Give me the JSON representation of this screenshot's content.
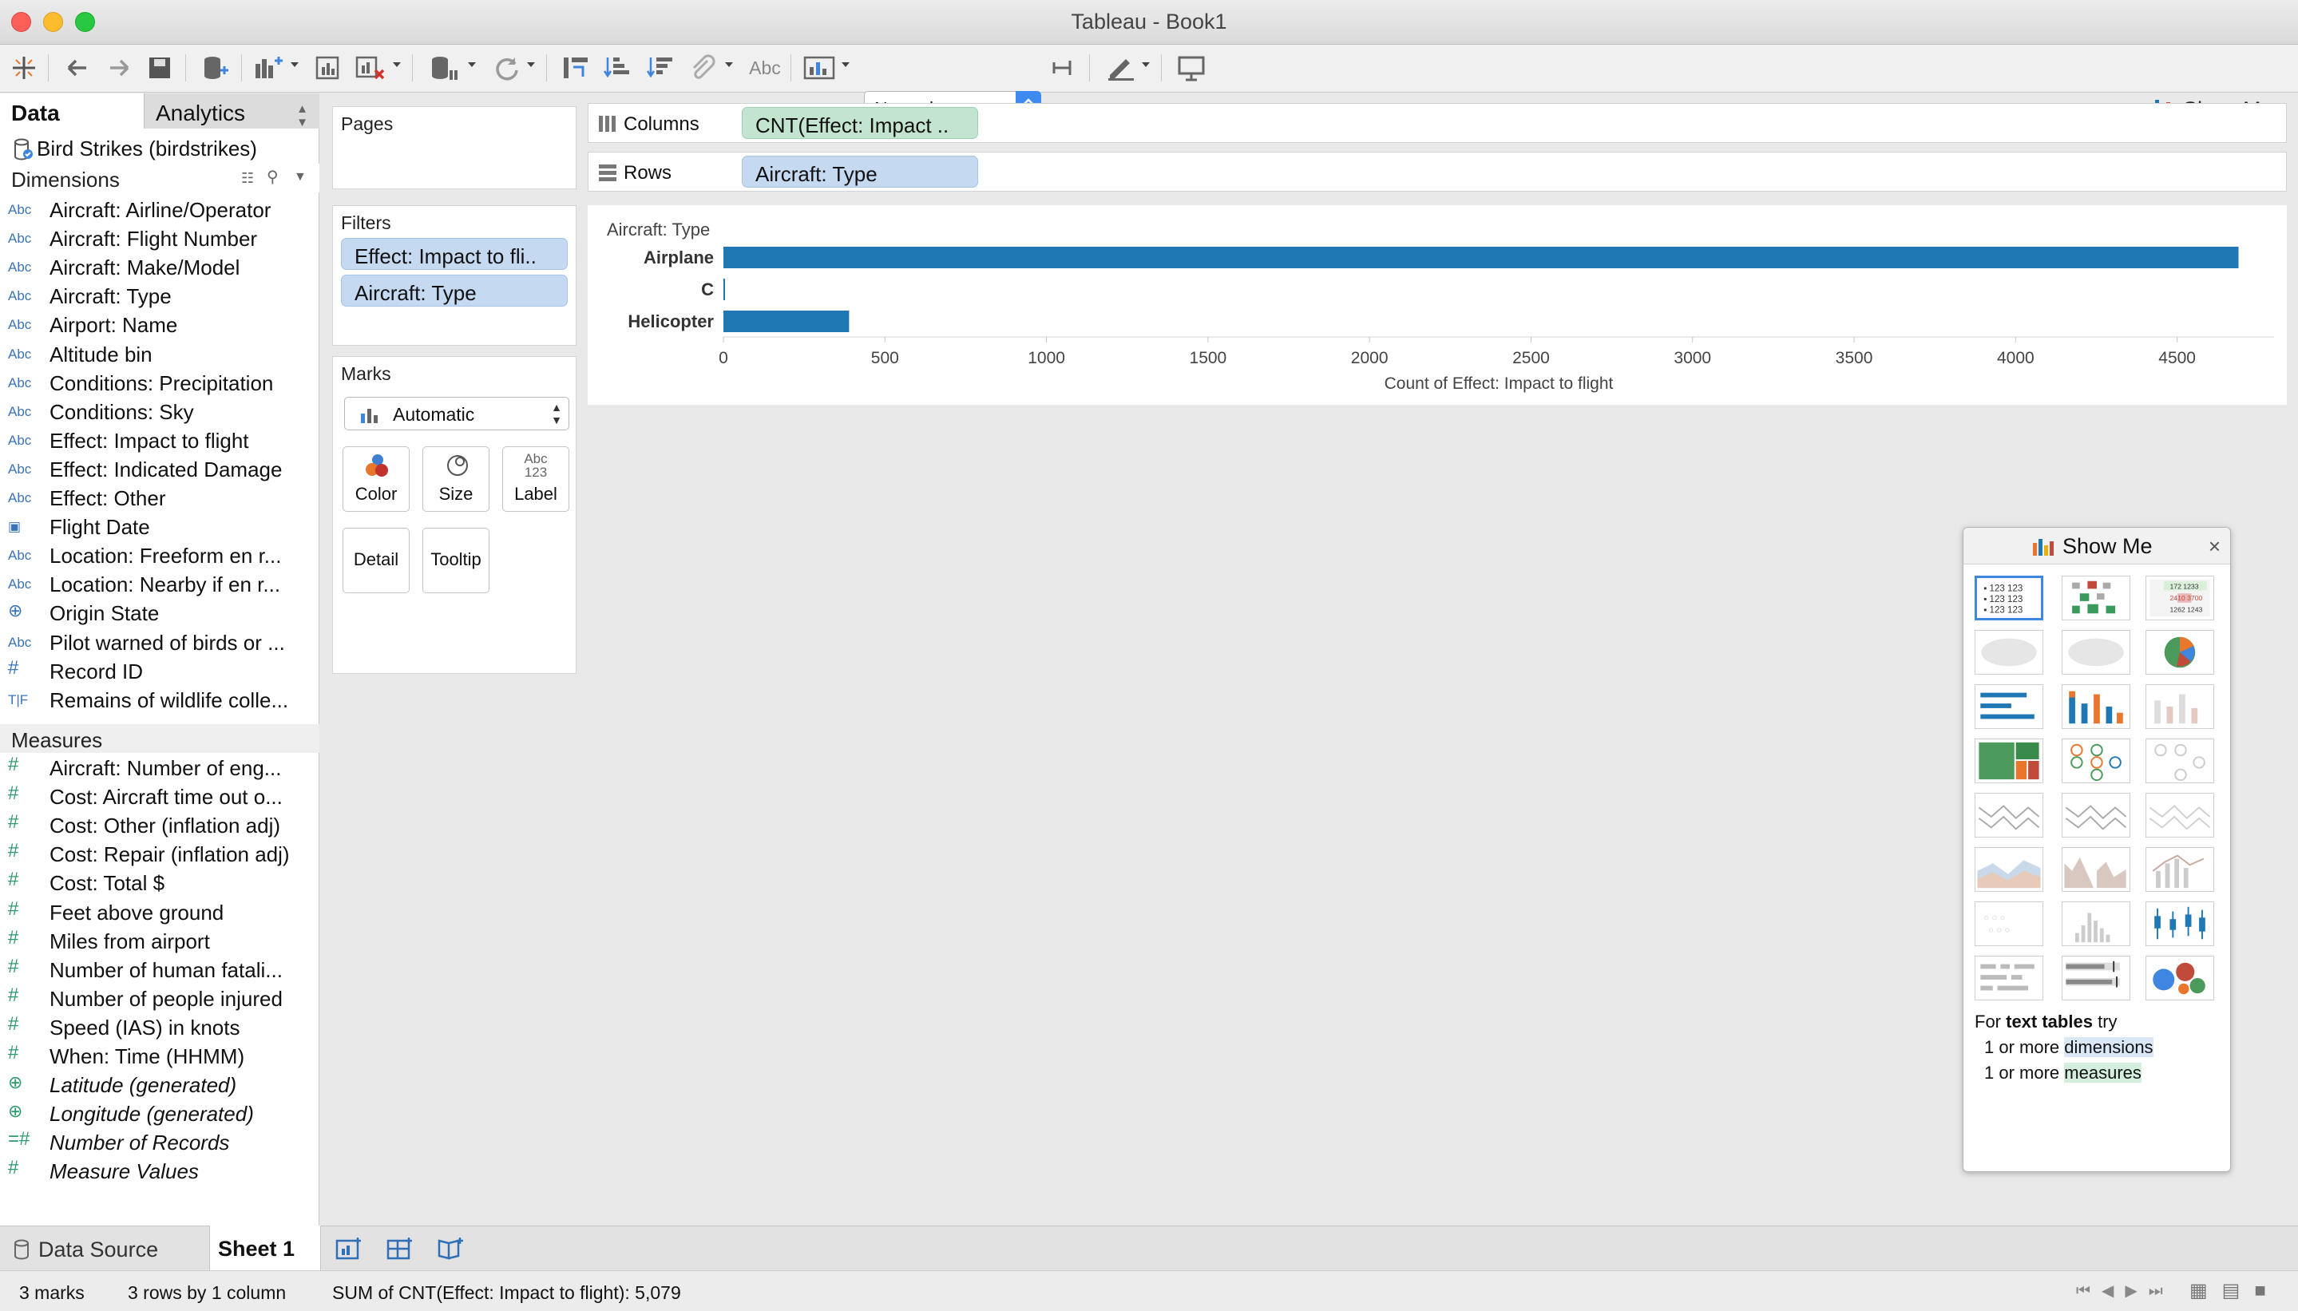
{
  "window": {
    "title": "Tableau - Book1"
  },
  "toolbar": {
    "fit_mode": "Normal",
    "show_me_label": "Show Me",
    "abc_label": "Abc"
  },
  "side_tabs": {
    "data": "Data",
    "analytics": "Analytics"
  },
  "datasource": {
    "name": "Bird Strikes (birdstrikes)"
  },
  "dimensions": {
    "header": "Dimensions",
    "items": [
      {
        "type": "Abc",
        "label": "Aircraft: Airline/Operator"
      },
      {
        "type": "Abc",
        "label": "Aircraft: Flight Number"
      },
      {
        "type": "Abc",
        "label": "Aircraft: Make/Model"
      },
      {
        "type": "Abc",
        "label": "Aircraft: Type"
      },
      {
        "type": "Abc",
        "label": "Airport: Name"
      },
      {
        "type": "Abc",
        "label": "Altitude bin"
      },
      {
        "type": "Abc",
        "label": "Conditions: Precipitation"
      },
      {
        "type": "Abc",
        "label": "Conditions: Sky"
      },
      {
        "type": "Abc",
        "label": "Effect: Impact to flight"
      },
      {
        "type": "Abc",
        "label": "Effect: Indicated Damage"
      },
      {
        "type": "Abc",
        "label": "Effect: Other"
      },
      {
        "type": "date",
        "label": "Flight Date"
      },
      {
        "type": "Abc",
        "label": "Location: Freeform en r..."
      },
      {
        "type": "Abc",
        "label": "Location: Nearby if en r..."
      },
      {
        "type": "geo",
        "label": "Origin State"
      },
      {
        "type": "Abc",
        "label": "Pilot warned of birds or ..."
      },
      {
        "type": "#",
        "label": "Record ID"
      },
      {
        "type": "T|F",
        "label": "Remains of wildlife colle..."
      }
    ]
  },
  "measures": {
    "header": "Measures",
    "items": [
      {
        "type": "#",
        "label": "Aircraft: Number of eng...",
        "italic": false
      },
      {
        "type": "#",
        "label": "Cost: Aircraft time out o...",
        "italic": false
      },
      {
        "type": "#",
        "label": "Cost: Other (inflation adj)",
        "italic": false
      },
      {
        "type": "#",
        "label": "Cost: Repair (inflation adj)",
        "italic": false
      },
      {
        "type": "#",
        "label": "Cost: Total $",
        "italic": false
      },
      {
        "type": "#",
        "label": "Feet above ground",
        "italic": false
      },
      {
        "type": "#",
        "label": "Miles from airport",
        "italic": false
      },
      {
        "type": "#",
        "label": "Number of human fatali...",
        "italic": false
      },
      {
        "type": "#",
        "label": "Number of people injured",
        "italic": false
      },
      {
        "type": "#",
        "label": "Speed (IAS) in knots",
        "italic": false
      },
      {
        "type": "#",
        "label": "When: Time (HHMM)",
        "italic": false
      },
      {
        "type": "geo",
        "label": "Latitude (generated)",
        "italic": true
      },
      {
        "type": "geo",
        "label": "Longitude (generated)",
        "italic": true
      },
      {
        "type": "=#",
        "label": "Number of Records",
        "italic": true
      },
      {
        "type": "#",
        "label": "Measure Values",
        "italic": true
      }
    ]
  },
  "cards": {
    "pages": "Pages",
    "filters": "Filters",
    "filter_pills": [
      "Effect: Impact to fli..",
      "Aircraft: Type"
    ],
    "marks": "Marks",
    "mark_type": "Automatic",
    "mark_buttons": {
      "color": "Color",
      "size": "Size",
      "label": "Label",
      "detail": "Detail",
      "tooltip": "Tooltip",
      "label_glyph": "Abc 123"
    }
  },
  "shelves": {
    "columns_label": "Columns",
    "columns_pill": "CNT(Effect: Impact ..",
    "rows_label": "Rows",
    "rows_pill": "Aircraft: Type"
  },
  "chart_data": {
    "type": "bar",
    "orientation": "horizontal",
    "categories": [
      "Airplane",
      "C",
      "Helicopter"
    ],
    "values": [
      4690,
      5,
      389
    ],
    "ylabel": "Aircraft: Type",
    "xlabel": "Count of Effect: Impact to flight",
    "xlim": [
      0,
      4800
    ],
    "xticks": [
      0,
      500,
      1000,
      1500,
      2000,
      2500,
      3000,
      3500,
      4000,
      4500
    ],
    "bar_color": "#1f77b4"
  },
  "show_me": {
    "title": "Show Me",
    "close": "×",
    "hint_prefix": "For",
    "hint_bold": "text tables",
    "hint_suffix": "try",
    "req1_prefix": "1 or more",
    "req1_hl": "dimensions",
    "req2_prefix": "1 or more",
    "req2_hl": "measures"
  },
  "bottom_tabs": {
    "data_source": "Data Source",
    "sheet": "Sheet 1"
  },
  "status": {
    "marks": "3 marks",
    "dims": "3 rows by 1 column",
    "sum": "SUM of CNT(Effect: Impact to flight): 5,079"
  }
}
